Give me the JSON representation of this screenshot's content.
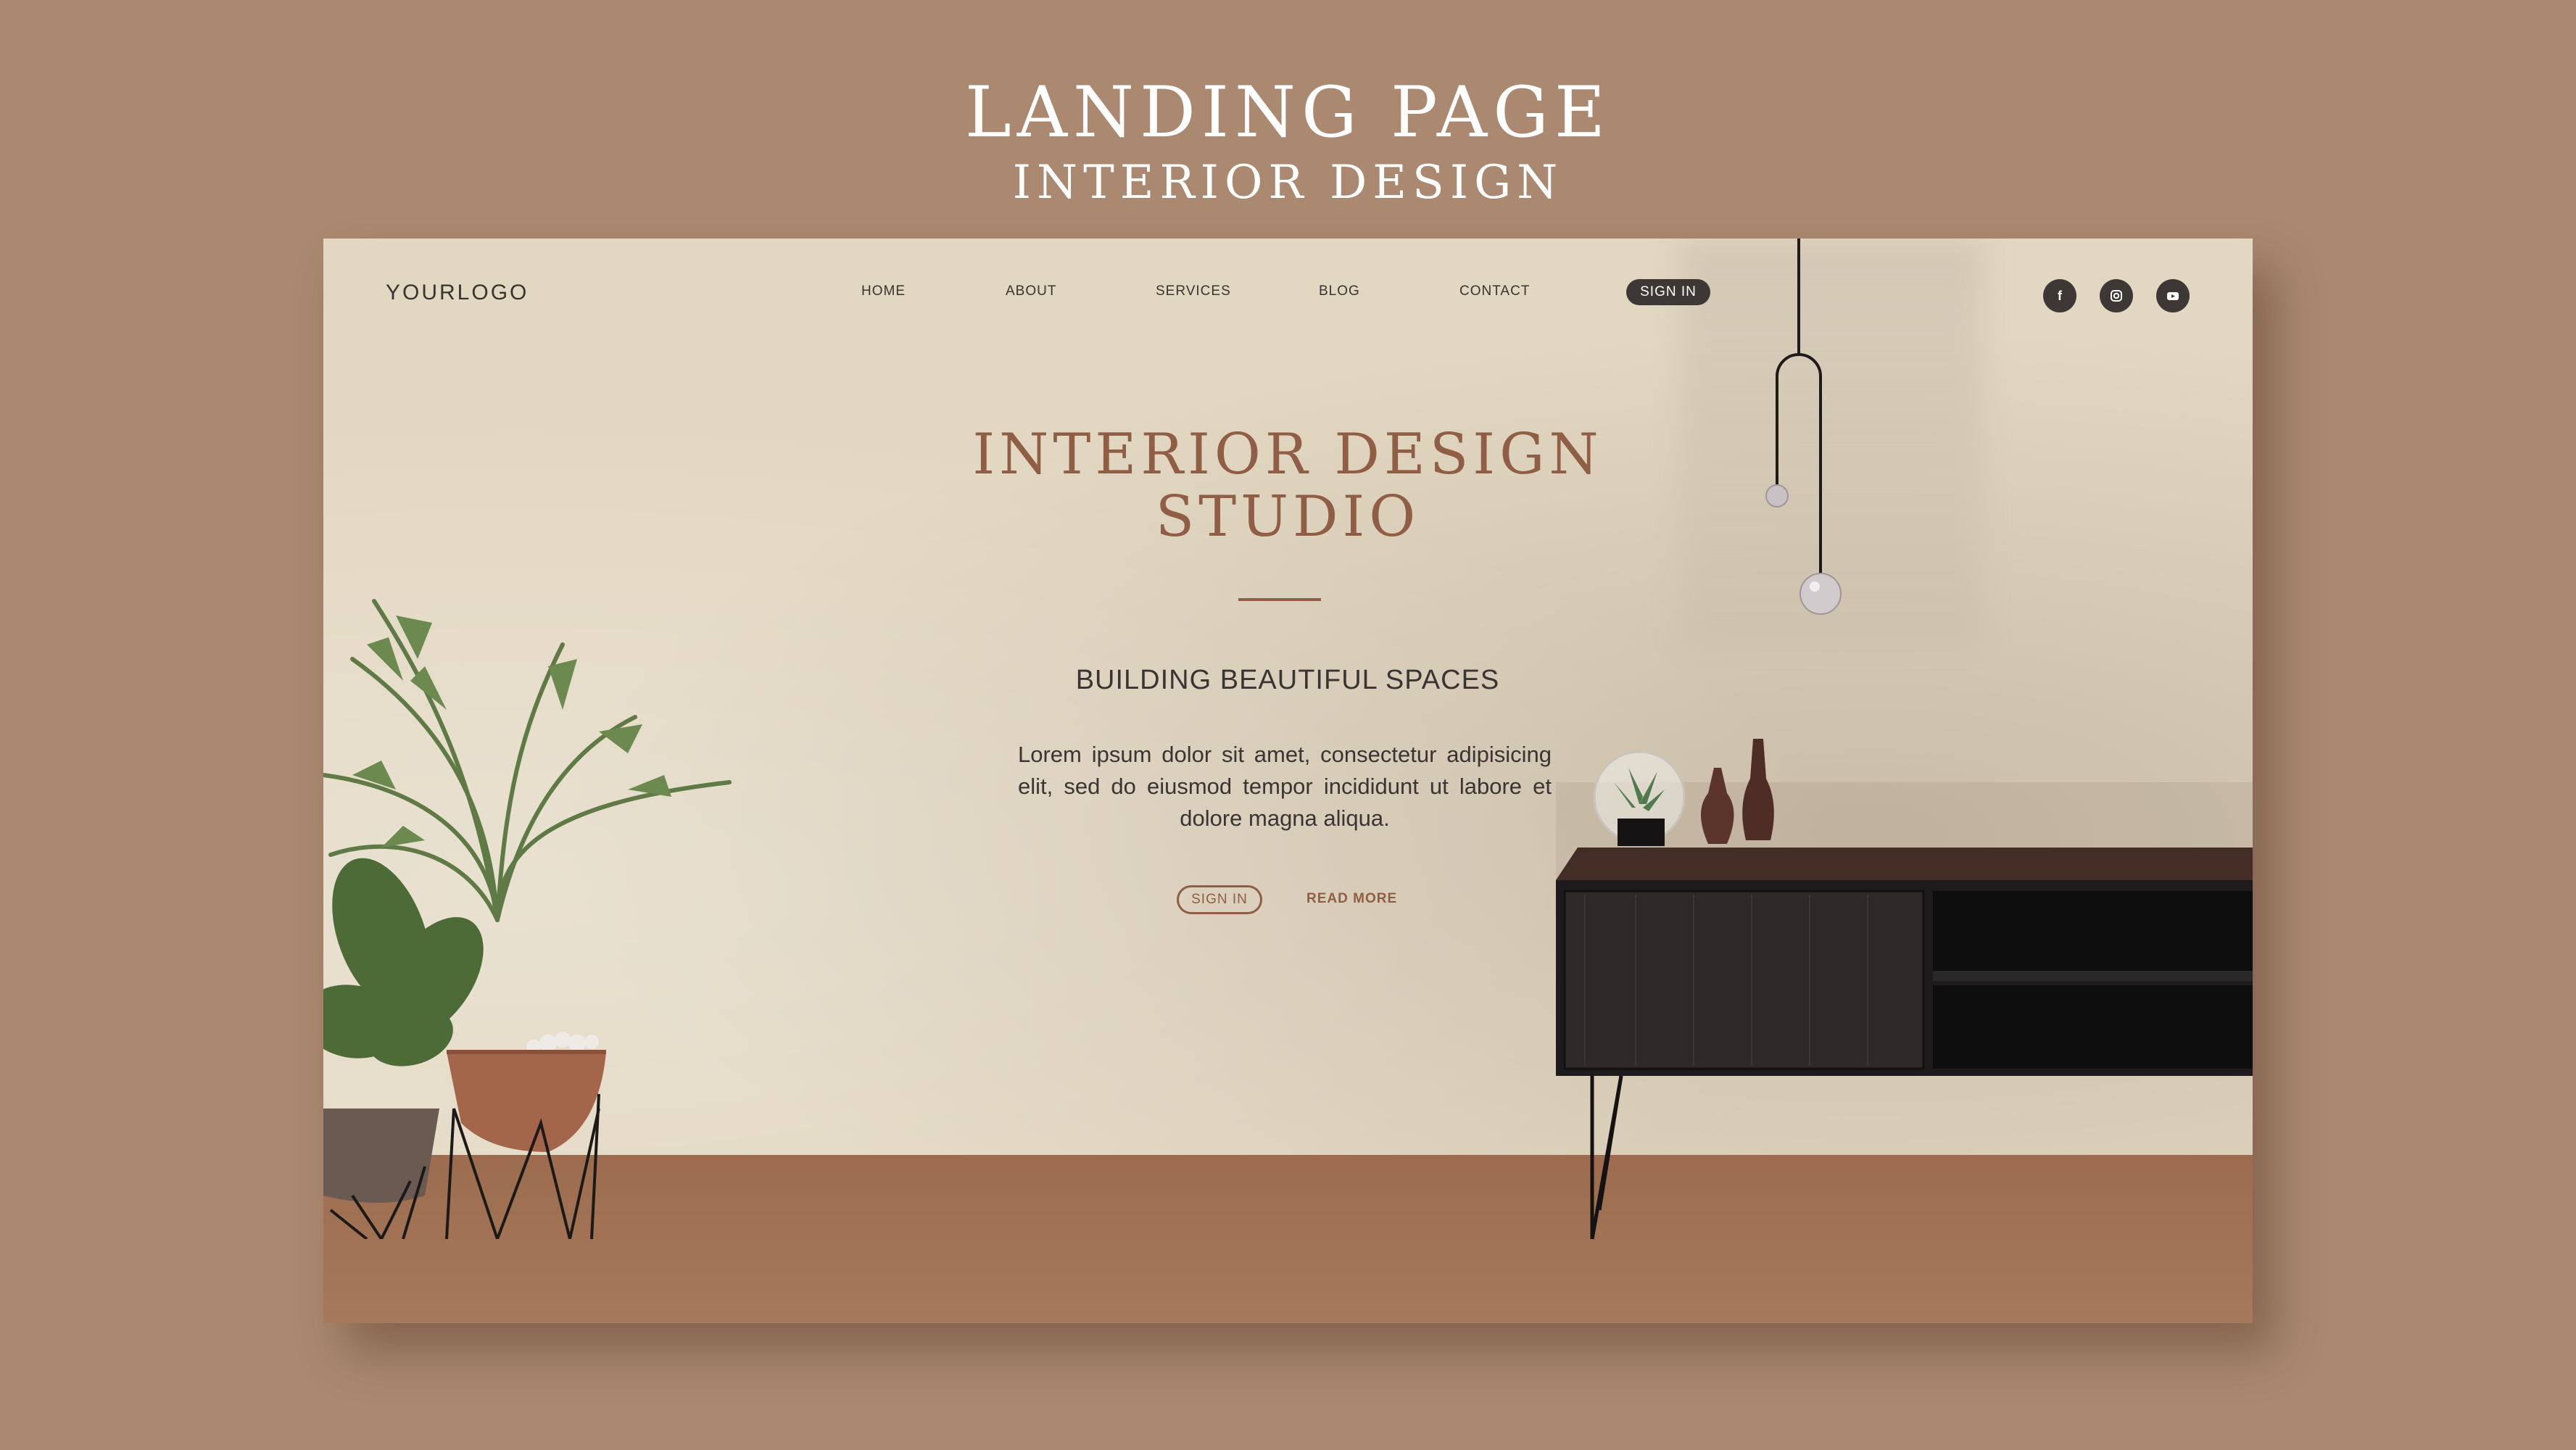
{
  "showcase": {
    "title_line1": "LANDING PAGE",
    "title_line2": "INTERIOR DESIGN"
  },
  "nav": {
    "logo": "YOURLOGO",
    "items": [
      {
        "label": "HOME"
      },
      {
        "label": "ABOUT"
      },
      {
        "label": "SERVICES"
      },
      {
        "label": "BLOG"
      },
      {
        "label": "CONTACT"
      }
    ],
    "signin_label": "SIGN IN",
    "social": [
      {
        "icon": "facebook-icon",
        "glyph": "f"
      },
      {
        "icon": "instagram-icon"
      },
      {
        "icon": "youtube-icon"
      }
    ]
  },
  "hero": {
    "title_line1": "INTERIOR DESIGN",
    "title_line2": "STUDIO",
    "subtitle": "BUILDING BEAUTIFUL SPACES",
    "body": "Lorem ipsum dolor sit amet, consectetur adipisicing elit, sed do eiusmod tempor incididunt ut labore et dolore magna aliqua.",
    "signin_button": "SIGN IN",
    "readmore_link": "READ MORE"
  },
  "colors": {
    "page_background": "#ab8970",
    "wall": "#e2d7c1",
    "floor": "#9d6c4e",
    "accent": "#8f5e44",
    "dark": "#3d3836"
  }
}
